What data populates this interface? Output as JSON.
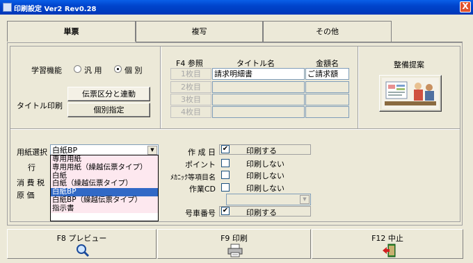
{
  "window": {
    "title": "印刷設定 Ver2 Rev0.28",
    "close_label": "X"
  },
  "tabs": [
    {
      "label": "単票"
    },
    {
      "label": "複写"
    },
    {
      "label": "その他"
    }
  ],
  "learning": {
    "label": "学習機能",
    "option_general": "汎 用",
    "option_individual": "個 別",
    "selected": "個 別"
  },
  "title_print": {
    "label": "タイトル印刷",
    "btn_linked": "伝票区分と連動",
    "btn_individual": "個別指定"
  },
  "title_table": {
    "headers": {
      "ref": "F4 参照",
      "title": "タイトル名",
      "amount": "金額名"
    },
    "rows": [
      {
        "label": "1枚目",
        "title": "請求明細書",
        "amount": "ご請求額"
      },
      {
        "label": "2枚目",
        "title": "",
        "amount": ""
      },
      {
        "label": "3枚目",
        "title": "",
        "amount": ""
      },
      {
        "label": "4枚目",
        "title": "",
        "amount": ""
      }
    ]
  },
  "suggestion": {
    "label": "整備提案"
  },
  "paper": {
    "label": "用紙選択",
    "selected": "白紙BP",
    "options": [
      "専用用紙",
      "専用用紙（繰越伝票タイプ）",
      "白紙",
      "白紙（繰越伝票タイプ）",
      "白紙BP",
      "白紙BP（繰越伝票タイプ）",
      "指示書"
    ],
    "highlighted": "白紙BP"
  },
  "left_labels": {
    "row": "行",
    "tax": "消 費 税",
    "cost": "原 価"
  },
  "print_options": [
    {
      "label": "作 成 日",
      "checked": true,
      "value": "印刷する"
    },
    {
      "label": "ポイント",
      "checked": false,
      "value": "印刷しない"
    },
    {
      "label": "ﾒｶﾆｯｸ等項目名",
      "checked": false,
      "value": "印刷しない"
    },
    {
      "label": "作業CD",
      "checked": false,
      "value": "印刷しない"
    }
  ],
  "plate": {
    "label": "号車番号",
    "checked": true,
    "value": "印刷する"
  },
  "footer": {
    "preview": "F8 プレビュー",
    "print": "F9 印刷",
    "cancel": "F12 中止"
  }
}
